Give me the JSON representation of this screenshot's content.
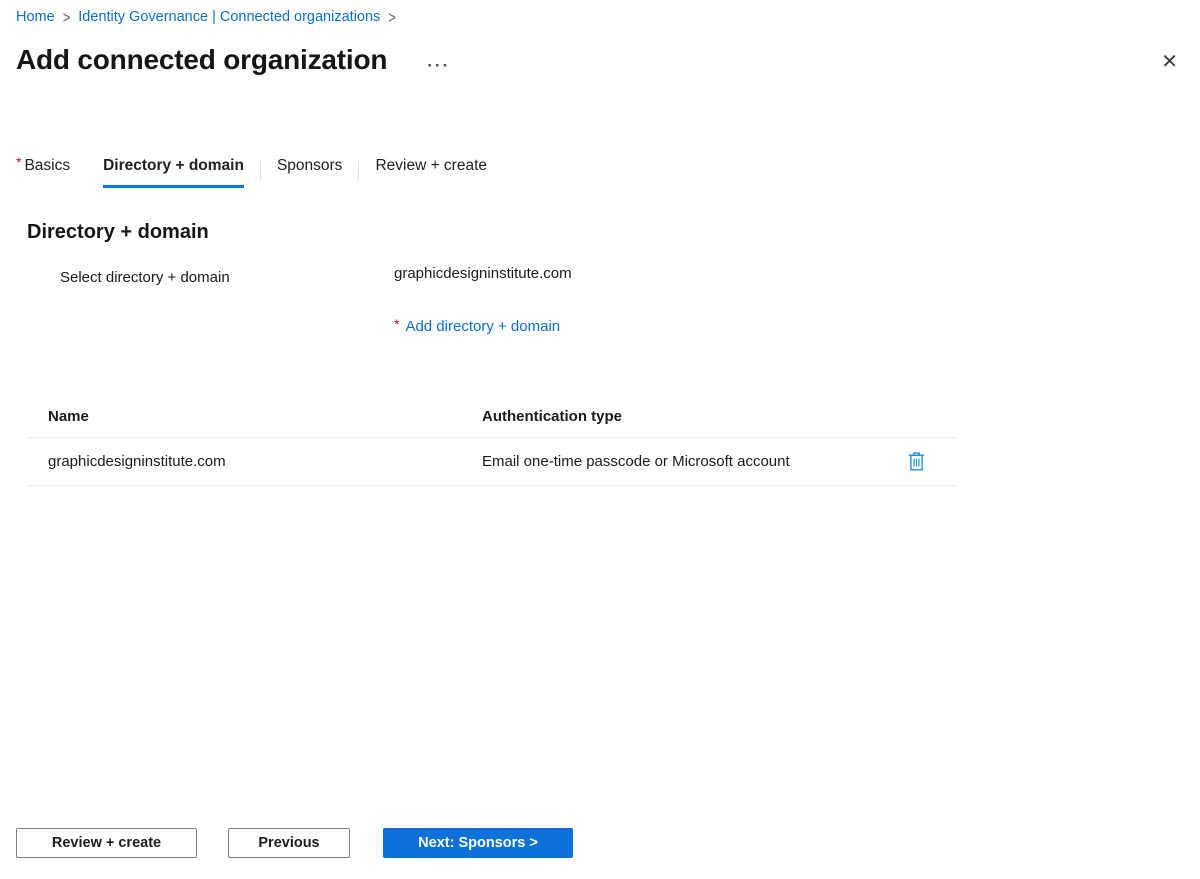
{
  "marks": {
    "required": "*",
    "breadcrumb_separator": ">"
  },
  "icons": {
    "close": "✕",
    "more": "···"
  },
  "breadcrumb": {
    "items": [
      "Home",
      "Identity Governance | Connected organizations"
    ]
  },
  "header": {
    "title": "Add connected organization"
  },
  "tabs": [
    {
      "label": "Basics",
      "required": true,
      "active": false
    },
    {
      "label": "Directory + domain",
      "required": false,
      "active": true
    },
    {
      "label": "Sponsors",
      "required": false,
      "active": false
    },
    {
      "label": "Review + create",
      "required": false,
      "active": false
    }
  ],
  "content": {
    "section_heading": "Directory + domain",
    "field_label": "Select directory + domain",
    "field_value": "graphicdesigninstitute.com",
    "add_link_label": "Add directory + domain"
  },
  "table": {
    "columns": [
      "Name",
      "Authentication type"
    ],
    "rows": [
      {
        "name": "graphicdesigninstitute.com",
        "auth_type": "Email one-time passcode or Microsoft account"
      }
    ]
  },
  "footer": {
    "review_create": "Review + create",
    "previous": "Previous",
    "next": "Next: Sponsors >"
  },
  "colors": {
    "link_blue": "#0b6fd0",
    "primary_blue": "#0c71d8",
    "required_red": "#c50f1f",
    "icon_blue": "#1e90e8",
    "divider": "#edebe9",
    "text_dark": "#1b1b1b"
  }
}
